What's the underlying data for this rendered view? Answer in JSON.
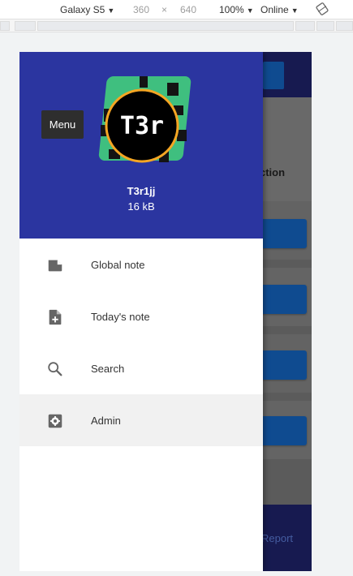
{
  "devtools": {
    "device": "Galaxy S5",
    "width": "360",
    "times": "×",
    "height": "640",
    "zoom": "100%",
    "network": "Online"
  },
  "page_behind": {
    "text_fragment": "ction",
    "footer_link": "Report"
  },
  "drawer": {
    "tooltip": "Menu",
    "avatar_text": "T3r",
    "username": "T3r1jj",
    "size": "16 kB",
    "items": [
      {
        "label": "Global note",
        "icon": "note-icon"
      },
      {
        "label": "Today's note",
        "icon": "note-add-icon"
      },
      {
        "label": "Search",
        "icon": "search-icon"
      },
      {
        "label": "Admin",
        "icon": "settings-icon",
        "active": true
      }
    ]
  },
  "colors": {
    "drawer_header": "#2b35a0",
    "app_header": "#1f236b",
    "button_blue": "#1565c0",
    "avatar_green": "#3fbf7f",
    "avatar_ring": "#f5a623"
  }
}
